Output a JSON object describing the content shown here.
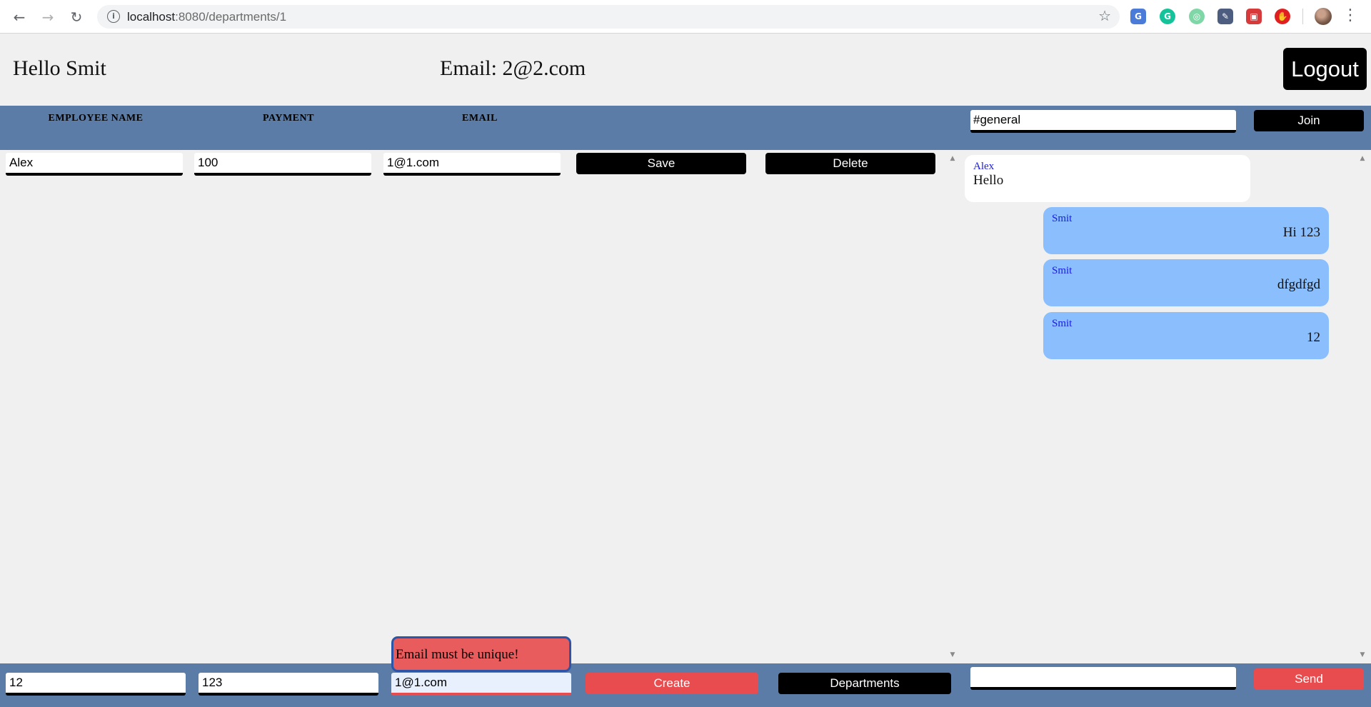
{
  "browser": {
    "url_host": "localhost",
    "url_rest": ":8080/departments/1",
    "back_icon": "←",
    "forward_icon": "→",
    "reload_icon": "↻",
    "info_icon": "i",
    "star_icon": "☆",
    "menu_icon": "⋮",
    "extensions": [
      {
        "name": "google-translate-icon",
        "glyph": "G",
        "color": "#4a7bd9"
      },
      {
        "name": "grammarly-icon",
        "glyph": "G",
        "color": "#15c39a"
      },
      {
        "name": "color-circle-icon",
        "glyph": "◎",
        "color": "#7fd6a6"
      },
      {
        "name": "eyedropper-icon",
        "glyph": "✎",
        "color": "#4d5d80"
      },
      {
        "name": "rc-extension-icon",
        "glyph": "▣",
        "color": "#d63a3a"
      },
      {
        "name": "adblock-icon",
        "glyph": "✋",
        "color": "#e02020"
      }
    ]
  },
  "header": {
    "greeting": "Hello Smit",
    "email": "Email: 2@2.com",
    "logout_label": "Logout"
  },
  "table": {
    "columns": [
      "EMPLOYEE NAME",
      "PAYMENT",
      "EMAIL"
    ],
    "rows": [
      {
        "name": "Alex",
        "payment": "100",
        "email": "1@1.com",
        "save_label": "Save",
        "delete_label": "Delete"
      }
    ]
  },
  "chat": {
    "channel": "#general",
    "join_label": "Join",
    "messages": [
      {
        "author": "Alex",
        "text": "Hello",
        "own": false
      },
      {
        "author": "Smit",
        "text": "Hi 123",
        "own": true
      },
      {
        "author": "Smit",
        "text": "dfgdfgd",
        "own": true
      },
      {
        "author": "Smit",
        "text": "12",
        "own": true
      }
    ],
    "message_input": "",
    "send_label": "Send"
  },
  "create_form": {
    "name": "12",
    "payment": "123",
    "email": "1@1.com",
    "error": "Email must be unique!",
    "create_label": "Create",
    "departments_label": "Departments"
  },
  "scroll": {
    "up_icon": "▲",
    "down_icon": "▼"
  },
  "colors": {
    "bar": "#5b7ca6",
    "accent_red": "#e84c4f",
    "own_message": "#8abefc"
  }
}
